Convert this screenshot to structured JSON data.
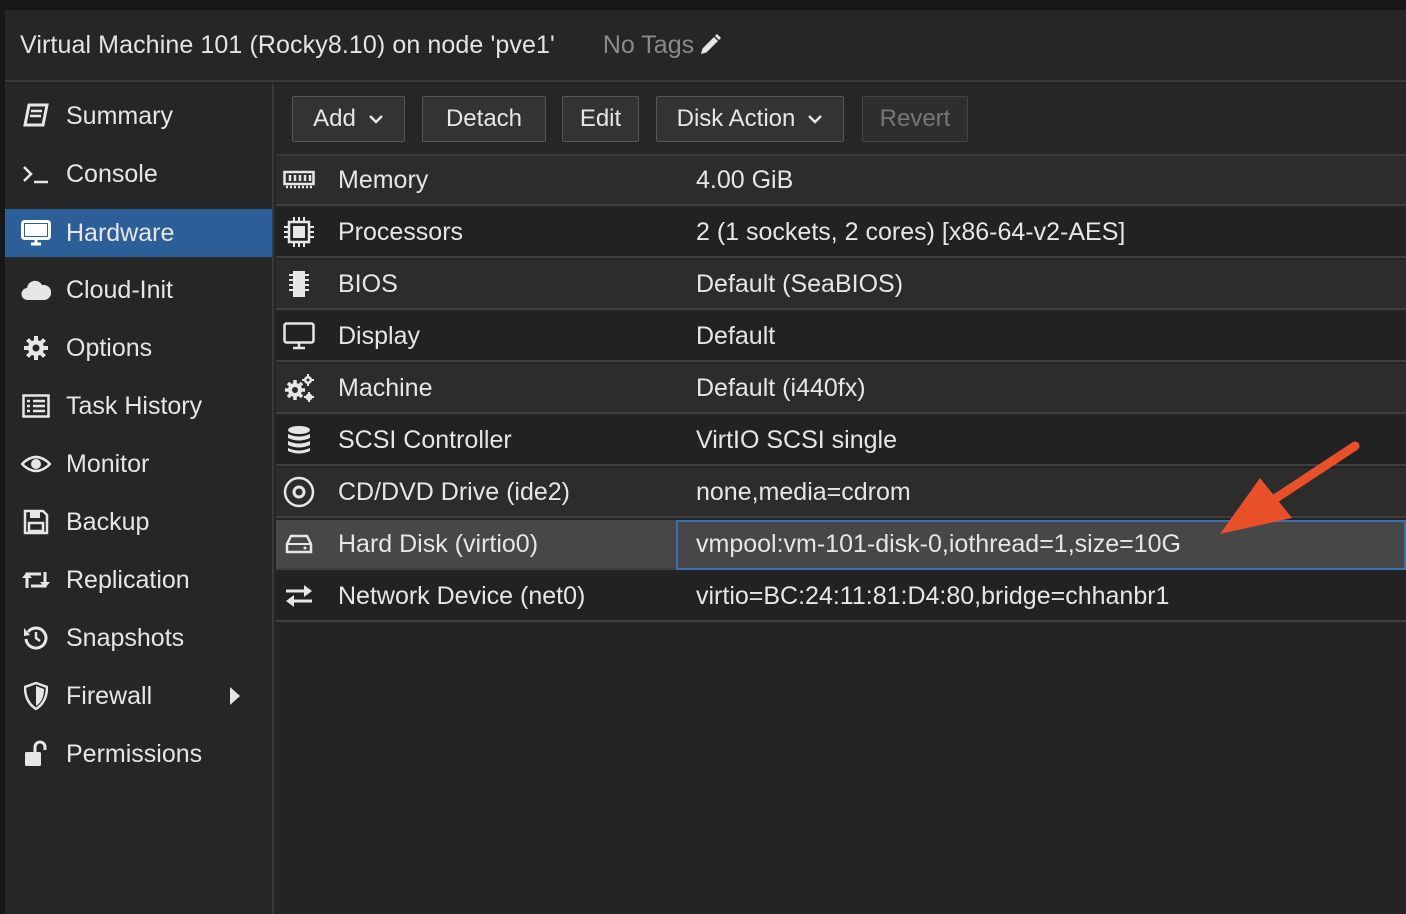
{
  "window": {
    "title": "Virtual Machine 101 (Rocky8.10) on node 'pve1'",
    "tags_label": "No Tags"
  },
  "sidebar": {
    "items": [
      {
        "label": "Summary",
        "icon": "book-icon"
      },
      {
        "label": "Console",
        "icon": "terminal-icon"
      },
      {
        "label": "Hardware",
        "icon": "monitor-icon",
        "active": true
      },
      {
        "label": "Cloud-Init",
        "icon": "cloud-icon"
      },
      {
        "label": "Options",
        "icon": "gear-icon"
      },
      {
        "label": "Task History",
        "icon": "list-icon"
      },
      {
        "label": "Monitor",
        "icon": "eye-icon"
      },
      {
        "label": "Backup",
        "icon": "floppy-icon"
      },
      {
        "label": "Replication",
        "icon": "retweet-icon"
      },
      {
        "label": "Snapshots",
        "icon": "history-icon"
      },
      {
        "label": "Firewall",
        "icon": "shield-icon",
        "submenu": true
      },
      {
        "label": "Permissions",
        "icon": "unlock-icon"
      }
    ]
  },
  "toolbar": {
    "add_label": "Add",
    "detach_label": "Detach",
    "edit_label": "Edit",
    "disk_action_label": "Disk Action",
    "revert_label": "Revert"
  },
  "hardware": {
    "rows": [
      {
        "name": "Memory",
        "value": "4.00 GiB",
        "icon": "memory-icon"
      },
      {
        "name": "Processors",
        "value": "2 (1 sockets, 2 cores) [x86-64-v2-AES]",
        "icon": "cpu-icon"
      },
      {
        "name": "BIOS",
        "value": "Default (SeaBIOS)",
        "icon": "microchip-icon"
      },
      {
        "name": "Display",
        "value": "Default",
        "icon": "display-icon"
      },
      {
        "name": "Machine",
        "value": "Default (i440fx)",
        "icon": "cogs-icon"
      },
      {
        "name": "SCSI Controller",
        "value": "VirtIO SCSI single",
        "icon": "database-icon"
      },
      {
        "name": "CD/DVD Drive (ide2)",
        "value": "none,media=cdrom",
        "icon": "cdrom-icon"
      },
      {
        "name": "Hard Disk (virtio0)",
        "value": "vmpool:vm-101-disk-0,iothread=1,size=10G",
        "icon": "hdd-icon",
        "selected": true
      },
      {
        "name": "Network Device (net0)",
        "value": "virtio=BC:24:11:81:D4:80,bridge=chhanbr1",
        "icon": "exchange-icon"
      }
    ]
  },
  "colors": {
    "active_nav": "#2c5f97",
    "selected_row": "#474747",
    "annotation_arrow": "#e8502a"
  }
}
